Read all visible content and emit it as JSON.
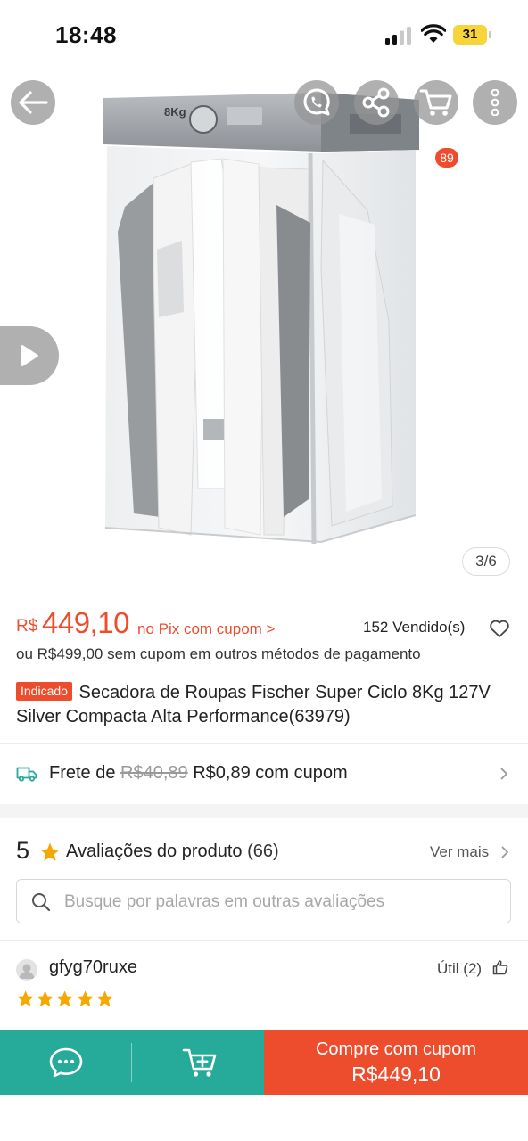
{
  "status_bar": {
    "time": "18:48",
    "battery": "31"
  },
  "colors": {
    "brand": "#ee4d2d",
    "chat_green": "#26aa99",
    "star": "#f6a700"
  },
  "image_gallery": {
    "counter": "3/6",
    "cart_badge": "89",
    "product_display_text": "8Kg",
    "icons": [
      "back-arrow-icon",
      "whatsapp-icon",
      "share-icon",
      "cart-icon",
      "more-vertical-icon",
      "play-icon"
    ]
  },
  "price": {
    "currency": "R$",
    "value": "449,10",
    "pix_note": "no Pix com cupom >",
    "sold": "152 Vendido(s)",
    "alt_price": "ou R$499,00 sem cupom em outros métodos de pagamento"
  },
  "product": {
    "tag": "Indicado",
    "title": "Secadora de Roupas Fischer Super Ciclo 8Kg 127V Silver Compacta Alta Performance(63979)"
  },
  "shipping": {
    "prefix": "Frete de",
    "old_price": "R$40,89",
    "new_price": "R$0,89 com cupom"
  },
  "reviews": {
    "rating": "5",
    "title": "Avaliações do produto",
    "count": "(66)",
    "see_more": "Ver mais",
    "search_placeholder": "Busque por palavras em outras avaliações",
    "items": [
      {
        "user": "gfyg70ruxe",
        "useful": "Útil (2)",
        "stars": 5
      }
    ]
  },
  "bottom_bar": {
    "buy_label": "Compre com cupom",
    "buy_price": "R$449,10"
  }
}
